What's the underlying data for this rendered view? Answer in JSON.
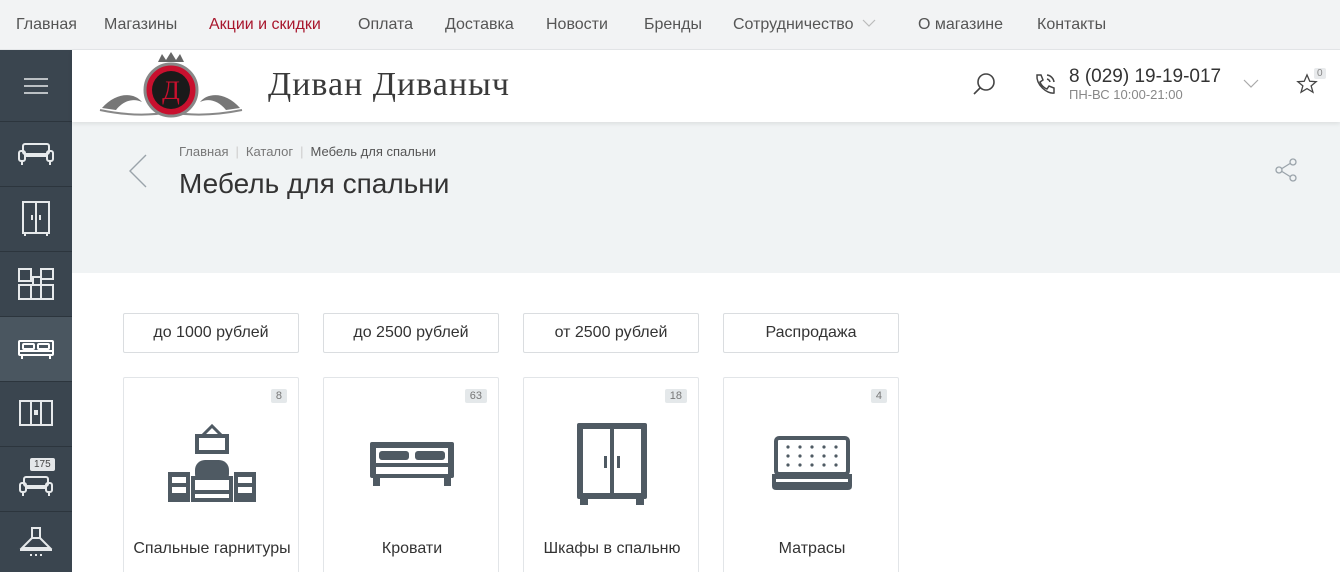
{
  "topnav": {
    "items": [
      "Главная",
      "Магазины",
      "Акции и скидки",
      "Оплата",
      "Доставка",
      "Новости",
      "Бренды",
      "Сотрудничество",
      "О магазине",
      "Контакты"
    ]
  },
  "header": {
    "logo_text": "Диван Диваныч",
    "logo_letter": "Д",
    "phone": "8 (029) 19-19-017",
    "hours": "ПН-ВС 10:00-21:00",
    "favorites_count": "0"
  },
  "sidebar": {
    "items": [
      {
        "icon": "menu-icon"
      },
      {
        "icon": "sofa-icon"
      },
      {
        "icon": "wardrobe-icon"
      },
      {
        "icon": "kitchen-icon"
      },
      {
        "icon": "bed-icon",
        "active": true
      },
      {
        "icon": "closet-icon"
      },
      {
        "icon": "armchair-icon",
        "badge": "175"
      },
      {
        "icon": "range-hood-icon"
      }
    ]
  },
  "breadcrumb": [
    "Главная",
    "Каталог",
    "Мебель для спальни"
  ],
  "page_title": "Мебель для спальни",
  "filters": [
    "до 1000 рублей",
    "до 2500 рублей",
    "от 2500 рублей",
    "Распродажа"
  ],
  "categories": [
    {
      "label": "Спальные гарнитуры",
      "count": "8",
      "icon": "bedroom-set-icon"
    },
    {
      "label": "Кровати",
      "count": "63",
      "icon": "bed-icon"
    },
    {
      "label": "Шкафы в спальню",
      "count": "18",
      "icon": "wardrobe-icon"
    },
    {
      "label": "Матрасы",
      "count": "4",
      "icon": "mattress-icon"
    }
  ],
  "colors": {
    "accent": "#a8172d",
    "sidebar": "#3a454f",
    "icon": "#4f5a63"
  }
}
